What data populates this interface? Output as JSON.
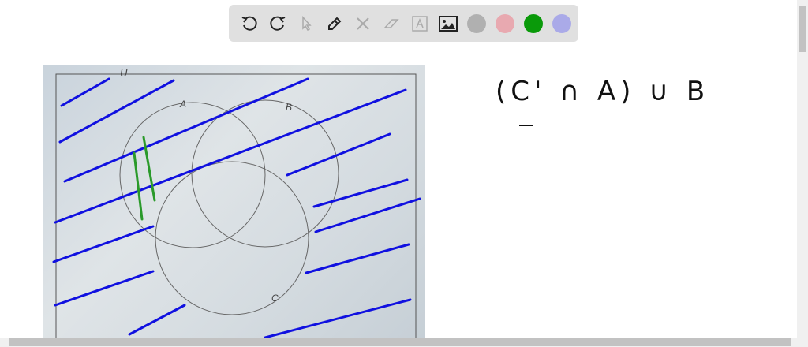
{
  "toolbar": {
    "tools": [
      "undo",
      "redo",
      "select",
      "pen",
      "tools",
      "eraser",
      "text",
      "image"
    ],
    "colors": [
      "#b0b0b0",
      "#e8a9b0",
      "#0a9a0a",
      "#aaaae8"
    ]
  },
  "photo": {
    "labels": {
      "u": "U",
      "a": "A",
      "b": "B",
      "c": "C"
    }
  },
  "note": {
    "expression": "(C' ∩ A) ∪ B"
  },
  "ink": {
    "blue": "#1010e0",
    "green": "#2a9a2a"
  }
}
